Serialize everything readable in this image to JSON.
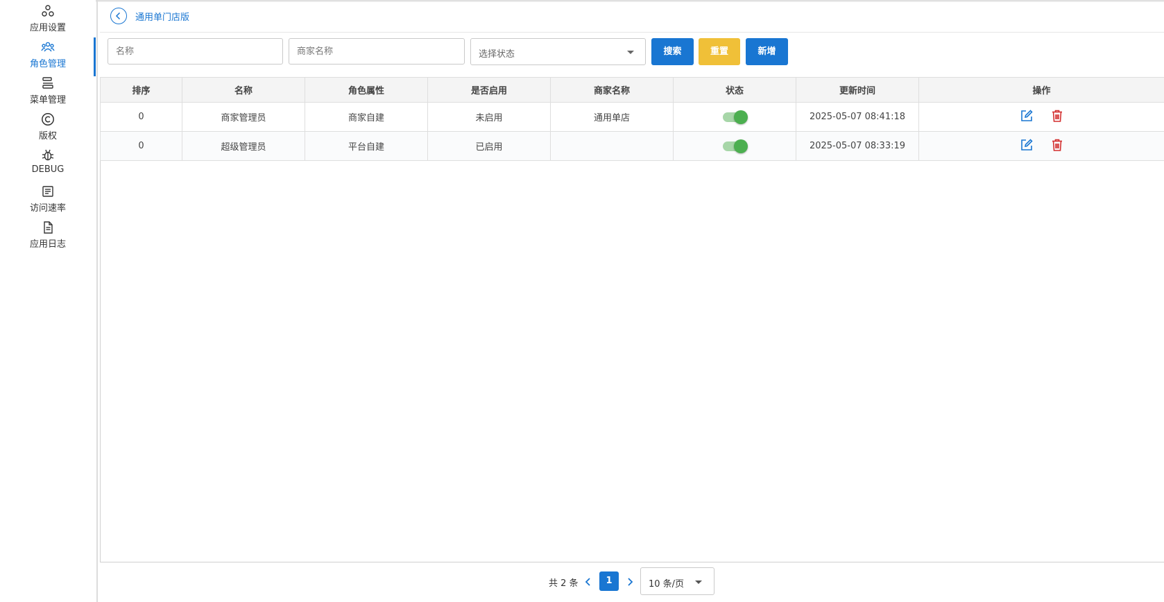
{
  "sidebar": {
    "items": [
      {
        "label": "应用设置",
        "icon": "app-settings-icon"
      },
      {
        "label": "角色管理",
        "icon": "users-icon",
        "active": true
      },
      {
        "label": "菜单管理",
        "icon": "menu-icon"
      },
      {
        "label": "版权",
        "icon": "copyright-icon"
      },
      {
        "label": "DEBUG",
        "icon": "bug-icon"
      },
      {
        "label": "访问速率",
        "icon": "article-icon"
      },
      {
        "label": "应用日志",
        "icon": "document-icon"
      }
    ]
  },
  "header": {
    "title": "通用单门店版"
  },
  "filters": {
    "name_placeholder": "名称",
    "merchant_placeholder": "商家名称",
    "status_placeholder": "选择状态",
    "search_label": "搜索",
    "reset_label": "重置",
    "add_label": "新增"
  },
  "table": {
    "columns": [
      "排序",
      "名称",
      "角色属性",
      "是否启用",
      "商家名称",
      "状态",
      "更新时间",
      "操作"
    ],
    "rows": [
      {
        "sort": "0",
        "name": "商家管理员",
        "attr": "商家自建",
        "enabled": "未启用",
        "merchant": "通用单店",
        "status_on": true,
        "updated": "2025-05-07 08:41:18"
      },
      {
        "sort": "0",
        "name": "超级管理员",
        "attr": "平台自建",
        "enabled": "已启用",
        "merchant": "",
        "status_on": true,
        "updated": "2025-05-07 08:33:19"
      }
    ]
  },
  "pagination": {
    "total_text": "共 2 条",
    "current_page": "1",
    "page_size": "10 条/页"
  },
  "colors": {
    "primary": "#1976d2",
    "warning": "#f0c038",
    "switch_on": "#4caf50",
    "delete": "#d32f2f"
  }
}
